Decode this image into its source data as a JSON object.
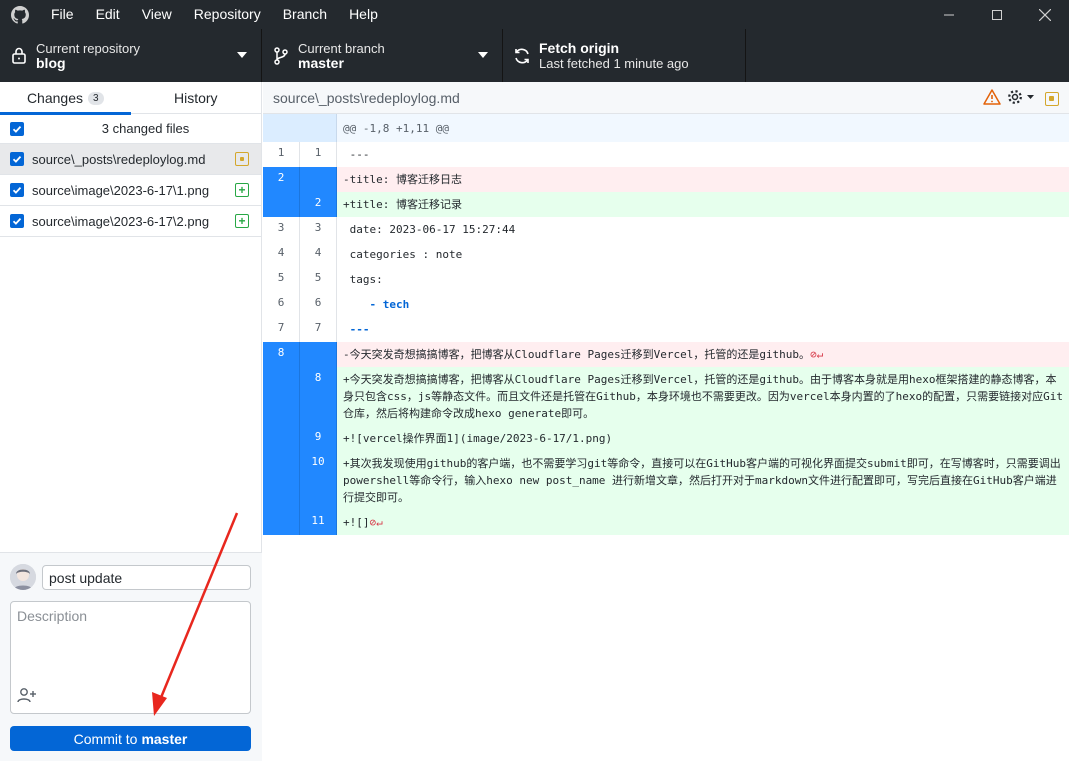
{
  "menu": [
    "File",
    "Edit",
    "View",
    "Repository",
    "Branch",
    "Help"
  ],
  "toolbar": {
    "repo_label": "Current repository",
    "repo_value": "blog",
    "branch_label": "Current branch",
    "branch_value": "master",
    "fetch_title": "Fetch origin",
    "fetch_sub": "Last fetched 1 minute ago"
  },
  "tabs": {
    "changes": "Changes",
    "changes_count": "3",
    "history": "History"
  },
  "changes": {
    "header": "3 changed files",
    "files": [
      {
        "name": "source\\_posts\\redeploylog.md",
        "status": "modified"
      },
      {
        "name": "source\\image\\2023-6-17\\1.png",
        "status": "added"
      },
      {
        "name": "source\\image\\2023-6-17\\2.png",
        "status": "added"
      }
    ]
  },
  "commit": {
    "summary": "post update",
    "description_placeholder": "Description",
    "button_prefix": "Commit to",
    "button_branch": "master"
  },
  "diff": {
    "path": "source\\_posts\\redeploylog.md",
    "hunk": "@@ -1,8 +1,11 @@",
    "lines": [
      {
        "type": "ctx",
        "old": "1",
        "new": "1",
        "text": " ---"
      },
      {
        "type": "del",
        "old": "2",
        "new": "",
        "text": "-title: 博客迁移日志"
      },
      {
        "type": "add",
        "old": "",
        "new": "2",
        "text": "+title: 博客迁移记录"
      },
      {
        "type": "ctx",
        "old": "3",
        "new": "3",
        "text": " date: 2023-06-17 15:27:44"
      },
      {
        "type": "ctx",
        "old": "4",
        "new": "4",
        "text": " categories : note"
      },
      {
        "type": "ctx",
        "old": "5",
        "new": "5",
        "text": " tags:"
      },
      {
        "type": "ctx",
        "old": "6",
        "new": "6",
        "text": "    - tech"
      },
      {
        "type": "ctx",
        "old": "7",
        "new": "7",
        "text": " ---"
      },
      {
        "type": "del",
        "old": "8",
        "new": "",
        "text": "-今天突发奇想搞搞博客，把博客从Cloudflare Pages迁移到Vercel，托管的还是github。"
      },
      {
        "type": "add",
        "old": "",
        "new": "8",
        "text": "+今天突发奇想搞搞博客，把博客从Cloudflare Pages迁移到Vercel，托管的还是github。由于博客本身就是用hexo框架搭建的静态博客，本身只包含css，js等静态文件。而且文件还是托管在Github，本身环境也不需要更改。因为vercel本身内置的了hexo的配置，只需要链接对应Git仓库，然后将构建命令改成hexo generate即可。"
      },
      {
        "type": "add",
        "old": "",
        "new": "9",
        "text": "+![vercel操作界面1](image/2023-6-17/1.png)"
      },
      {
        "type": "add",
        "old": "",
        "new": "10",
        "text": "+其次我发现使用github的客户端，也不需要学习git等命令，直接可以在GitHub客户端的可视化界面提交submit即可，在写博客时，只需要调出powershell等命令行，输入hexo new post_name 进行新增文章，然后打开对于markdown文件进行配置即可，写完后直接在GitHub客户端进行提交即可。"
      },
      {
        "type": "add",
        "old": "",
        "new": "11",
        "text": "+![]"
      }
    ]
  }
}
